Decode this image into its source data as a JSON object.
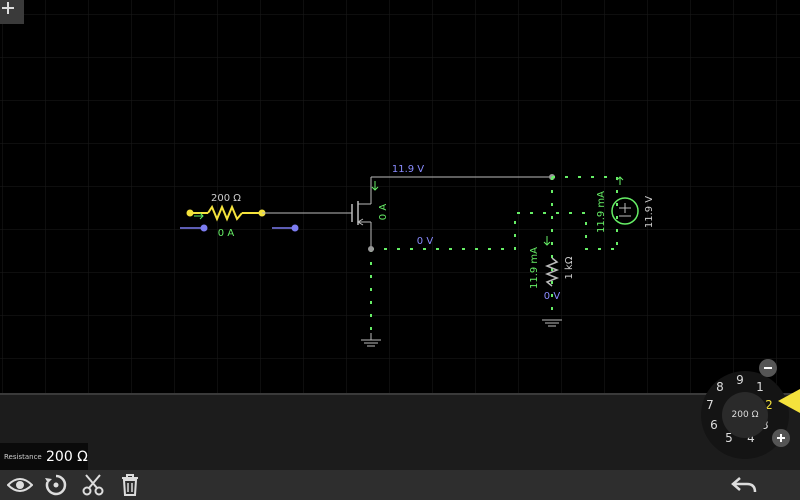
{
  "circuit": {
    "resistor_label": "200 Ω",
    "resistor_current": "0 A",
    "drain_voltage": "11.9 V",
    "mosfet_current": "0 A",
    "source_voltage": "0 V",
    "load_current": "11.9 mA",
    "load_resistance": "1 kΩ",
    "load_voltage": "0 V",
    "source_current": "11.9 mA",
    "battery_voltage": "11.9 V"
  },
  "property": {
    "label": "Resistance",
    "value": "200 Ω"
  },
  "dial": {
    "center": "200 Ω",
    "numbers": [
      "9",
      "1",
      "2",
      "3",
      "4",
      "5",
      "6",
      "7",
      "8"
    ],
    "selected": "2"
  },
  "colors": {
    "current_dot": "#66ee66",
    "wire": "#bbbbbb",
    "terminal_high": "#f4e23c",
    "terminal_low": "#7c7cf0",
    "voltage_label": "#8a8cff",
    "dial_indicator": "#f4e23c"
  },
  "toolbar": {
    "icons": [
      "eye-icon",
      "rotate-icon",
      "scissors-icon",
      "trash-icon",
      "undo-icon"
    ]
  }
}
